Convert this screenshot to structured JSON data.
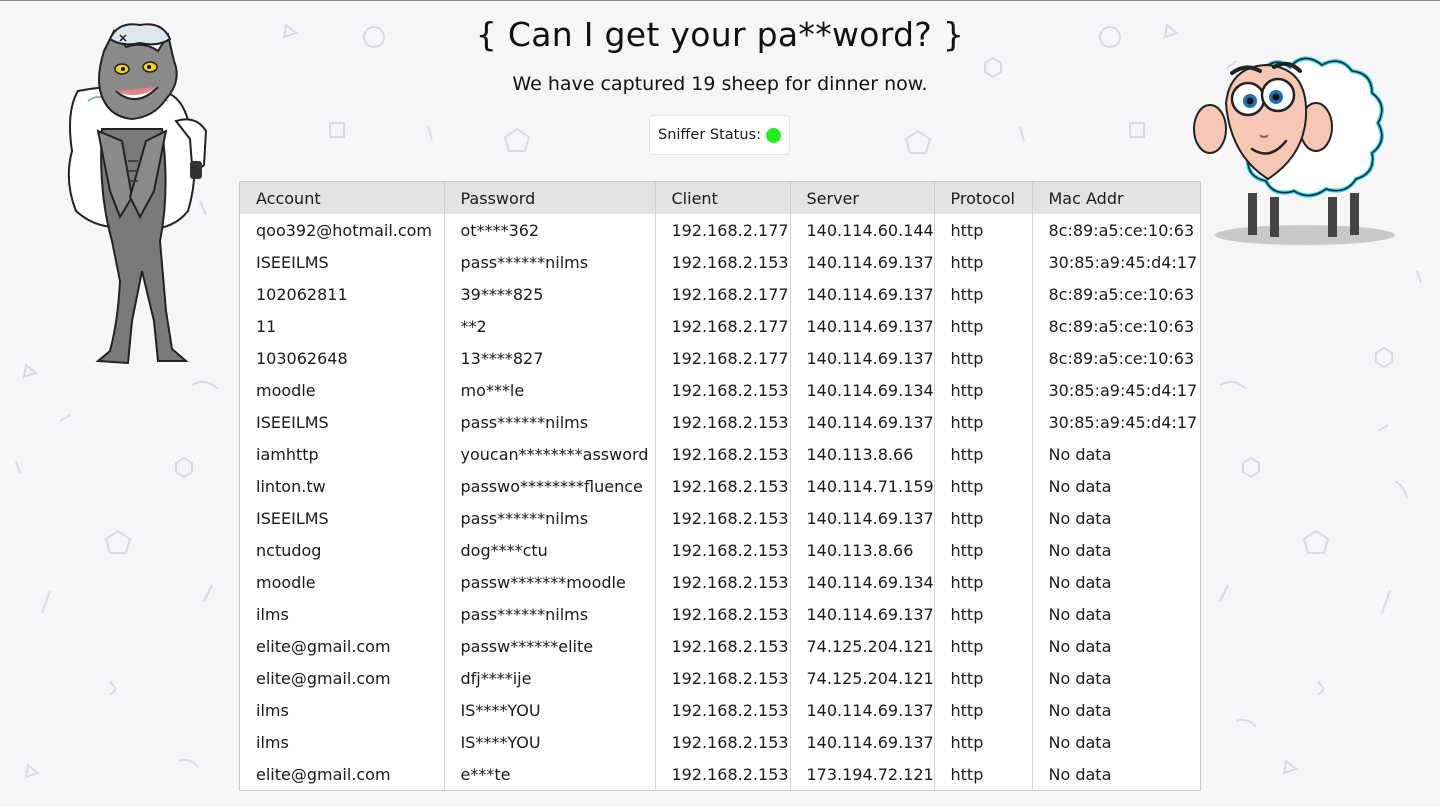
{
  "header": {
    "title": "{ Can I get your pa**word? }",
    "subtitle": "We have captured 19 sheep for dinner now.",
    "sniffer_label": "Sniffer Status:",
    "sniffer_color": "#22ee22"
  },
  "images": {
    "left": "wolf-in-sheep-clothing-illustration",
    "right": "sheep-cartoon-illustration"
  },
  "table": {
    "columns": [
      "Account",
      "Password",
      "Client",
      "Server",
      "Protocol",
      "Mac Addr"
    ],
    "rows": [
      [
        "qoo392@hotmail.com",
        "ot****362",
        "192.168.2.177",
        "140.114.60.144",
        "http",
        "8c:89:a5:ce:10:63"
      ],
      [
        "ISEEILMS",
        "pass******nilms",
        "192.168.2.153",
        "140.114.69.137",
        "http",
        "30:85:a9:45:d4:17"
      ],
      [
        "102062811",
        "39****825",
        "192.168.2.177",
        "140.114.69.137",
        "http",
        "8c:89:a5:ce:10:63"
      ],
      [
        "11",
        "**2",
        "192.168.2.177",
        "140.114.69.137",
        "http",
        "8c:89:a5:ce:10:63"
      ],
      [
        "103062648",
        "13****827",
        "192.168.2.177",
        "140.114.69.137",
        "http",
        "8c:89:a5:ce:10:63"
      ],
      [
        "moodle",
        "mo***le",
        "192.168.2.153",
        "140.114.69.134",
        "http",
        "30:85:a9:45:d4:17"
      ],
      [
        "ISEEILMS",
        "pass******nilms",
        "192.168.2.153",
        "140.114.69.137",
        "http",
        "30:85:a9:45:d4:17"
      ],
      [
        "iamhttp",
        "youcan********assword",
        "192.168.2.153",
        "140.113.8.66",
        "http",
        "No data"
      ],
      [
        "linton.tw",
        "passwo********fluence",
        "192.168.2.153",
        "140.114.71.159",
        "http",
        "No data"
      ],
      [
        "ISEEILMS",
        "pass******nilms",
        "192.168.2.153",
        "140.114.69.137",
        "http",
        "No data"
      ],
      [
        "nctudog",
        "dog****ctu",
        "192.168.2.153",
        "140.113.8.66",
        "http",
        "No data"
      ],
      [
        "moodle",
        "passw*******moodle",
        "192.168.2.153",
        "140.114.69.134",
        "http",
        "No data"
      ],
      [
        "ilms",
        "pass******nilms",
        "192.168.2.153",
        "140.114.69.137",
        "http",
        "No data"
      ],
      [
        "elite@gmail.com",
        "passw******elite",
        "192.168.2.153",
        "74.125.204.121",
        "http",
        "No data"
      ],
      [
        "elite@gmail.com",
        "dfj****ije",
        "192.168.2.153",
        "74.125.204.121",
        "http",
        "No data"
      ],
      [
        "ilms",
        "IS****YOU",
        "192.168.2.153",
        "140.114.69.137",
        "http",
        "No data"
      ],
      [
        "ilms",
        "IS****YOU",
        "192.168.2.153",
        "140.114.69.137",
        "http",
        "No data"
      ],
      [
        "elite@gmail.com",
        "e***te",
        "192.168.2.153",
        "173.194.72.121",
        "http",
        "No data"
      ]
    ]
  }
}
